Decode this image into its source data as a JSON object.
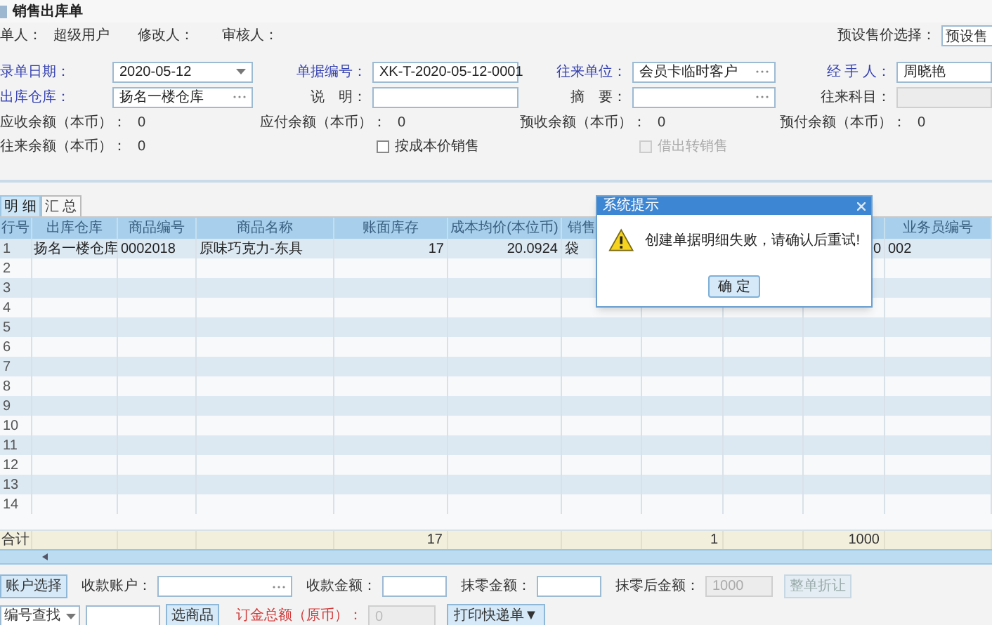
{
  "window": {
    "title": "销售出库单"
  },
  "info": [
    {
      "label": "单人：",
      "value": "超级用户"
    },
    {
      "label": "修改人："
    },
    {
      "label": "审核人："
    }
  ],
  "price_preset": {
    "label": "预设售价选择：",
    "value": "预设售"
  },
  "fields": [
    {
      "label": "录单日期：",
      "value": "2020-05-12",
      "kind": "select",
      "required": true
    },
    {
      "label": "单据编号：",
      "value": "XK-T-2020-05-12-0001",
      "kind": "text",
      "required": true
    },
    {
      "label": "往来单位：",
      "value": "会员卡临时客户",
      "kind": "lookup",
      "required": true
    },
    {
      "label": "经 手 人：",
      "value": "周晓艳",
      "kind": "text",
      "required": true
    },
    {
      "label": "出库仓库：",
      "value": "扬名一楼仓库",
      "kind": "lookup",
      "required": true
    },
    {
      "label": "说　明：",
      "kind": "text",
      "required": false
    },
    {
      "label": "摘　要：",
      "kind": "lookup",
      "required": false
    },
    {
      "label": "往来科目：",
      "kind": "disabled",
      "required": false
    }
  ],
  "balances": [
    {
      "label": "应收余额（本币）：",
      "value": "0"
    },
    {
      "label": "应付余额（本币）：",
      "value": "0"
    },
    {
      "label": "预收余额（本币）：",
      "value": "0"
    },
    {
      "label": "预付余额（本币）：",
      "value": "0"
    },
    {
      "label": "往来余额（本币）：",
      "value": "0"
    }
  ],
  "checkboxes": [
    {
      "label": "按成本价销售",
      "checked": false,
      "disabled": false
    },
    {
      "label": "借出转销售",
      "checked": false,
      "disabled": true
    }
  ],
  "tabs": [
    {
      "label": "明 细",
      "selected": true
    },
    {
      "label": "汇 总",
      "selected": false
    }
  ],
  "table": {
    "columns": [
      {
        "label": "行号"
      },
      {
        "label": "出库仓库"
      },
      {
        "label": "商品编号"
      },
      {
        "label": "商品名称"
      },
      {
        "label": "账面库存"
      },
      {
        "label": "成本均价(本位币)"
      },
      {
        "label": "销售"
      },
      {},
      {},
      {},
      {
        "label": "业务员编号"
      }
    ],
    "rows": [
      {
        "cells": {
          "0": "1",
          "1": "扬名一楼仓库",
          "2": "0002018",
          "3": "原味巧克力-东具",
          "4": "17",
          "5": "20.0924",
          "6": "袋",
          "9": "0",
          "10": "002"
        }
      },
      {
        "cells": {
          "0": "2"
        }
      },
      {
        "cells": {
          "0": "3"
        }
      },
      {
        "cells": {
          "0": "4"
        }
      },
      {
        "cells": {
          "0": "5"
        }
      },
      {
        "cells": {
          "0": "6"
        }
      },
      {
        "cells": {
          "0": "7"
        }
      },
      {
        "cells": {
          "0": "8"
        }
      },
      {
        "cells": {
          "0": "9"
        }
      },
      {
        "cells": {
          "0": "10"
        }
      },
      {
        "cells": {
          "0": "11"
        }
      },
      {
        "cells": {
          "0": "12"
        }
      },
      {
        "cells": {
          "0": "13"
        }
      },
      {
        "cells": {
          "0": "14"
        }
      }
    ],
    "totals": {
      "0": "合计",
      "4": "17",
      "7": "1",
      "9": "1000"
    }
  },
  "payment": {
    "account_button": "账户选择",
    "fields": [
      {
        "label": "收款账户：",
        "kind": "lookup"
      },
      {
        "label": "收款金额：",
        "kind": "text"
      },
      {
        "label": "抹零金额：",
        "kind": "text"
      },
      {
        "label": "抹零后金额：",
        "kind": "disabled",
        "value": "1000"
      }
    ],
    "discount_button": {
      "label": "整单折让",
      "disabled": true
    }
  },
  "search": {
    "mode": "编号查找",
    "pick_button": "选商品",
    "deposit_label": "订金总额（原币）：",
    "deposit_value": "0",
    "print_button": "打印快递单▼"
  },
  "dialog": {
    "title": "系统提示",
    "message": "创建单据明细失败，请确认后重试!",
    "button": "确 定"
  }
}
